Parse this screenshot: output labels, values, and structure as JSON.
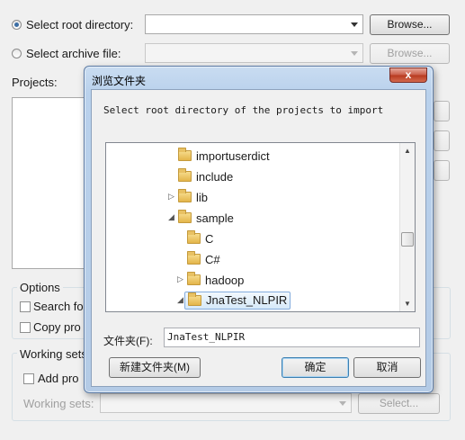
{
  "wizard": {
    "root_dir_label": "Select root directory:",
    "root_dir_value": "",
    "browse_label": "Browse...",
    "archive_label": "Select archive file:",
    "archive_browse_label": "Browse...",
    "projects_label": "Projects:",
    "options_group": "Options",
    "search_label": "Search fo",
    "copy_label": "Copy pro",
    "working_sets_group": "Working sets",
    "add_label": "Add pro",
    "working_sets_field_label": "Working sets:",
    "select_label": "Select..."
  },
  "dialog": {
    "title": "浏览文件夹",
    "close_glyph": "x",
    "instruction": "Select root directory of the projects to import",
    "tree": [
      {
        "label": "importuserdict",
        "expander": ""
      },
      {
        "label": "include",
        "expander": ""
      },
      {
        "label": "lib",
        "expander": "▷"
      },
      {
        "label": "sample",
        "expander": "◢"
      },
      {
        "label": "C",
        "expander": ""
      },
      {
        "label": "C#",
        "expander": ""
      },
      {
        "label": "hadoop",
        "expander": "▷"
      },
      {
        "label": "JnaTest_NLPIR",
        "expander": "◢"
      }
    ],
    "folder_label": "文件夹(F):",
    "folder_value": "JnaTest_NLPIR",
    "new_folder_label": "新建文件夹(M)",
    "ok_label": "确定",
    "cancel_label": "取消"
  }
}
